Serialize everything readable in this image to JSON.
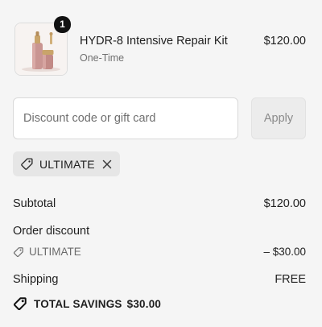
{
  "product": {
    "quantity": "1",
    "name": "HYDR-8 Intensive Repair Kit",
    "variant": "One-Time",
    "price": "$120.00",
    "image_icon": "product-bottles-image"
  },
  "discount": {
    "placeholder": "Discount code or gift card",
    "value": "",
    "apply_label": "Apply"
  },
  "applied_code": {
    "code": "ULTIMATE",
    "icon": "tag-icon",
    "remove_icon": "close-icon"
  },
  "summary": {
    "subtotal_label": "Subtotal",
    "subtotal_value": "$120.00",
    "order_discount_label": "Order discount",
    "discount_code": "ULTIMATE",
    "discount_value": "– $30.00",
    "shipping_label": "Shipping",
    "shipping_value": "FREE"
  },
  "savings": {
    "label": "TOTAL SAVINGS",
    "value": "$30.00"
  },
  "colors": {
    "background": "#f5f5f5",
    "badge": "#111111",
    "muted_text": "#707070",
    "button_disabled": "#ececec"
  }
}
